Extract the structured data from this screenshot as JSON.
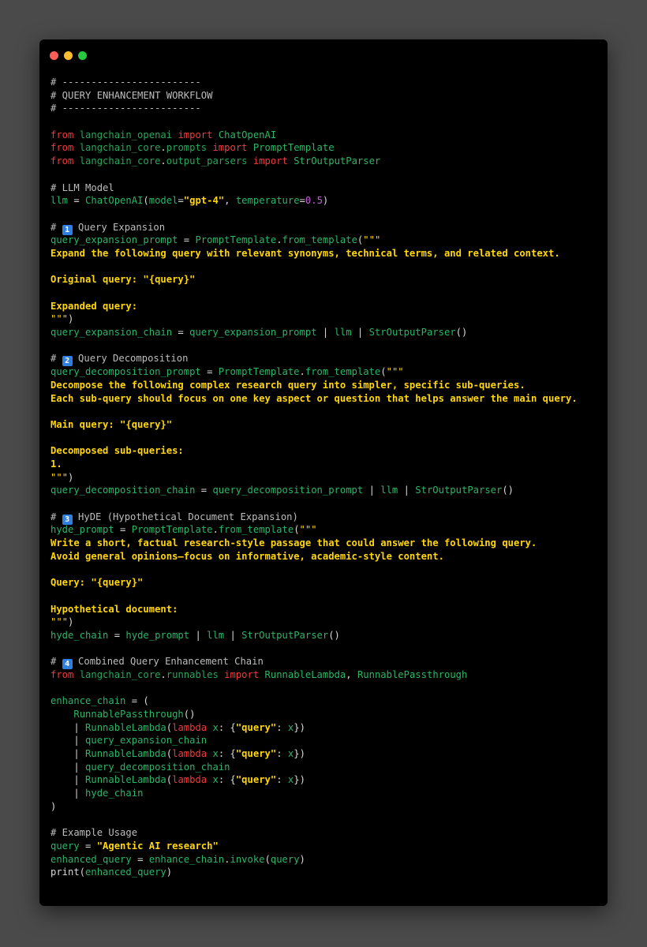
{
  "window": {
    "controls": [
      "close",
      "minimize",
      "zoom"
    ]
  },
  "colors": {
    "background": "#4a4a4a",
    "editor_bg": "#000000",
    "comment": "#bdbdbd",
    "keyword": "#ef3b3b",
    "identifier": "#29b764",
    "string": "#ffd60a",
    "number": "#c75bd8"
  },
  "code": {
    "lines": [
      [
        {
          "t": "comment",
          "v": "# ------------------------"
        }
      ],
      [
        {
          "t": "comment",
          "v": "# QUERY ENHANCEMENT WORKFLOW"
        }
      ],
      [
        {
          "t": "comment",
          "v": "# ------------------------"
        }
      ],
      [],
      [
        {
          "t": "kw",
          "v": "from "
        },
        {
          "t": "mod",
          "v": "langchain_openai "
        },
        {
          "t": "kw",
          "v": "import "
        },
        {
          "t": "cls",
          "v": "ChatOpenAI"
        }
      ],
      [
        {
          "t": "kw",
          "v": "from "
        },
        {
          "t": "mod",
          "v": "langchain_core"
        },
        {
          "t": "plain",
          "v": "."
        },
        {
          "t": "mod",
          "v": "prompts "
        },
        {
          "t": "kw",
          "v": "import "
        },
        {
          "t": "cls",
          "v": "PromptTemplate"
        }
      ],
      [
        {
          "t": "kw",
          "v": "from "
        },
        {
          "t": "mod",
          "v": "langchain_core"
        },
        {
          "t": "plain",
          "v": "."
        },
        {
          "t": "mod",
          "v": "output_parsers "
        },
        {
          "t": "kw",
          "v": "import "
        },
        {
          "t": "cls",
          "v": "StrOutputParser"
        }
      ],
      [],
      [
        {
          "t": "comment",
          "v": "# LLM Model"
        }
      ],
      [
        {
          "t": "id",
          "v": "llm"
        },
        {
          "t": "plain",
          "v": " = "
        },
        {
          "t": "cls",
          "v": "ChatOpenAI"
        },
        {
          "t": "plain",
          "v": "("
        },
        {
          "t": "id",
          "v": "model"
        },
        {
          "t": "plain",
          "v": "="
        },
        {
          "t": "str",
          "v": "\"gpt-4\""
        },
        {
          "t": "plain",
          "v": ", "
        },
        {
          "t": "id",
          "v": "temperature"
        },
        {
          "t": "plain",
          "v": "="
        },
        {
          "t": "num",
          "v": "0.5"
        },
        {
          "t": "plain",
          "v": ")"
        }
      ],
      [],
      [
        {
          "t": "comment",
          "v": "# "
        },
        {
          "t": "badge",
          "v": "1"
        },
        {
          "t": "comment",
          "v": " Query Expansion"
        }
      ],
      [
        {
          "t": "id",
          "v": "query_expansion_prompt"
        },
        {
          "t": "plain",
          "v": " = "
        },
        {
          "t": "cls",
          "v": "PromptTemplate"
        },
        {
          "t": "plain",
          "v": "."
        },
        {
          "t": "id",
          "v": "from_template"
        },
        {
          "t": "plain",
          "v": "("
        },
        {
          "t": "strl",
          "v": "\"\"\""
        }
      ],
      [
        {
          "t": "str",
          "v": "Expand the following query with relevant synonyms, technical terms, and related context."
        }
      ],
      [],
      [
        {
          "t": "str",
          "v": "Original query: \"{query}\""
        }
      ],
      [],
      [
        {
          "t": "str",
          "v": "Expanded query:"
        }
      ],
      [
        {
          "t": "strl",
          "v": "\"\"\""
        },
        {
          "t": "plain",
          "v": ")"
        }
      ],
      [
        {
          "t": "id",
          "v": "query_expansion_chain"
        },
        {
          "t": "plain",
          "v": " = "
        },
        {
          "t": "id",
          "v": "query_expansion_prompt"
        },
        {
          "t": "plain",
          "v": " | "
        },
        {
          "t": "id",
          "v": "llm"
        },
        {
          "t": "plain",
          "v": " | "
        },
        {
          "t": "cls",
          "v": "StrOutputParser"
        },
        {
          "t": "plain",
          "v": "()"
        }
      ],
      [],
      [
        {
          "t": "comment",
          "v": "# "
        },
        {
          "t": "badge",
          "v": "2"
        },
        {
          "t": "comment",
          "v": " Query Decomposition"
        }
      ],
      [
        {
          "t": "id",
          "v": "query_decomposition_prompt"
        },
        {
          "t": "plain",
          "v": " = "
        },
        {
          "t": "cls",
          "v": "PromptTemplate"
        },
        {
          "t": "plain",
          "v": "."
        },
        {
          "t": "id",
          "v": "from_template"
        },
        {
          "t": "plain",
          "v": "("
        },
        {
          "t": "strl",
          "v": "\"\"\""
        }
      ],
      [
        {
          "t": "str",
          "v": "Decompose the following complex research query into simpler, specific sub-queries."
        }
      ],
      [
        {
          "t": "str",
          "v": "Each sub-query should focus on one key aspect or question that helps answer the main query."
        }
      ],
      [],
      [
        {
          "t": "str",
          "v": "Main query: \"{query}\""
        }
      ],
      [],
      [
        {
          "t": "str",
          "v": "Decomposed sub-queries:"
        }
      ],
      [
        {
          "t": "str",
          "v": "1."
        }
      ],
      [
        {
          "t": "strl",
          "v": "\"\"\""
        },
        {
          "t": "plain",
          "v": ")"
        }
      ],
      [
        {
          "t": "id",
          "v": "query_decomposition_chain"
        },
        {
          "t": "plain",
          "v": " = "
        },
        {
          "t": "id",
          "v": "query_decomposition_prompt"
        },
        {
          "t": "plain",
          "v": " | "
        },
        {
          "t": "id",
          "v": "llm"
        },
        {
          "t": "plain",
          "v": " | "
        },
        {
          "t": "cls",
          "v": "StrOutputParser"
        },
        {
          "t": "plain",
          "v": "()"
        }
      ],
      [],
      [
        {
          "t": "comment",
          "v": "# "
        },
        {
          "t": "badge",
          "v": "3"
        },
        {
          "t": "comment",
          "v": " HyDE (Hypothetical Document Expansion)"
        }
      ],
      [
        {
          "t": "id",
          "v": "hyde_prompt"
        },
        {
          "t": "plain",
          "v": " = "
        },
        {
          "t": "cls",
          "v": "PromptTemplate"
        },
        {
          "t": "plain",
          "v": "."
        },
        {
          "t": "id",
          "v": "from_template"
        },
        {
          "t": "plain",
          "v": "("
        },
        {
          "t": "strl",
          "v": "\"\"\""
        }
      ],
      [
        {
          "t": "str",
          "v": "Write a short, factual research-style passage that could answer the following query."
        }
      ],
      [
        {
          "t": "str",
          "v": "Avoid general opinions—focus on informative, academic-style content."
        }
      ],
      [],
      [
        {
          "t": "str",
          "v": "Query: \"{query}\""
        }
      ],
      [],
      [
        {
          "t": "str",
          "v": "Hypothetical document:"
        }
      ],
      [
        {
          "t": "strl",
          "v": "\"\"\""
        },
        {
          "t": "plain",
          "v": ")"
        }
      ],
      [
        {
          "t": "id",
          "v": "hyde_chain"
        },
        {
          "t": "plain",
          "v": " = "
        },
        {
          "t": "id",
          "v": "hyde_prompt"
        },
        {
          "t": "plain",
          "v": " | "
        },
        {
          "t": "id",
          "v": "llm"
        },
        {
          "t": "plain",
          "v": " | "
        },
        {
          "t": "cls",
          "v": "StrOutputParser"
        },
        {
          "t": "plain",
          "v": "()"
        }
      ],
      [],
      [
        {
          "t": "comment",
          "v": "# "
        },
        {
          "t": "badge",
          "v": "4"
        },
        {
          "t": "comment",
          "v": " Combined Query Enhancement Chain"
        }
      ],
      [
        {
          "t": "kw",
          "v": "from "
        },
        {
          "t": "mod",
          "v": "langchain_core"
        },
        {
          "t": "plain",
          "v": "."
        },
        {
          "t": "mod",
          "v": "runnables "
        },
        {
          "t": "kw",
          "v": "import "
        },
        {
          "t": "cls",
          "v": "RunnableLambda"
        },
        {
          "t": "plain",
          "v": ", "
        },
        {
          "t": "cls",
          "v": "RunnablePassthrough"
        }
      ],
      [],
      [
        {
          "t": "id",
          "v": "enhance_chain"
        },
        {
          "t": "plain",
          "v": " = ("
        }
      ],
      [
        {
          "t": "plain",
          "v": "    "
        },
        {
          "t": "cls",
          "v": "RunnablePassthrough"
        },
        {
          "t": "plain",
          "v": "()"
        }
      ],
      [
        {
          "t": "plain",
          "v": "    | "
        },
        {
          "t": "cls",
          "v": "RunnableLambda"
        },
        {
          "t": "plain",
          "v": "("
        },
        {
          "t": "kw",
          "v": "lambda "
        },
        {
          "t": "id",
          "v": "x"
        },
        {
          "t": "plain",
          "v": ": {"
        },
        {
          "t": "str",
          "v": "\"query\""
        },
        {
          "t": "plain",
          "v": ": "
        },
        {
          "t": "id",
          "v": "x"
        },
        {
          "t": "plain",
          "v": "})"
        }
      ],
      [
        {
          "t": "plain",
          "v": "    | "
        },
        {
          "t": "id",
          "v": "query_expansion_chain"
        }
      ],
      [
        {
          "t": "plain",
          "v": "    | "
        },
        {
          "t": "cls",
          "v": "RunnableLambda"
        },
        {
          "t": "plain",
          "v": "("
        },
        {
          "t": "kw",
          "v": "lambda "
        },
        {
          "t": "id",
          "v": "x"
        },
        {
          "t": "plain",
          "v": ": {"
        },
        {
          "t": "str",
          "v": "\"query\""
        },
        {
          "t": "plain",
          "v": ": "
        },
        {
          "t": "id",
          "v": "x"
        },
        {
          "t": "plain",
          "v": "})"
        }
      ],
      [
        {
          "t": "plain",
          "v": "    | "
        },
        {
          "t": "id",
          "v": "query_decomposition_chain"
        }
      ],
      [
        {
          "t": "plain",
          "v": "    | "
        },
        {
          "t": "cls",
          "v": "RunnableLambda"
        },
        {
          "t": "plain",
          "v": "("
        },
        {
          "t": "kw",
          "v": "lambda "
        },
        {
          "t": "id",
          "v": "x"
        },
        {
          "t": "plain",
          "v": ": {"
        },
        {
          "t": "str",
          "v": "\"query\""
        },
        {
          "t": "plain",
          "v": ": "
        },
        {
          "t": "id",
          "v": "x"
        },
        {
          "t": "plain",
          "v": "})"
        }
      ],
      [
        {
          "t": "plain",
          "v": "    | "
        },
        {
          "t": "id",
          "v": "hyde_chain"
        }
      ],
      [
        {
          "t": "plain",
          "v": ")"
        }
      ],
      [],
      [
        {
          "t": "comment",
          "v": "# Example Usage"
        }
      ],
      [
        {
          "t": "id",
          "v": "query"
        },
        {
          "t": "plain",
          "v": " = "
        },
        {
          "t": "str",
          "v": "\"Agentic AI research\""
        }
      ],
      [
        {
          "t": "id",
          "v": "enhanced_query"
        },
        {
          "t": "plain",
          "v": " = "
        },
        {
          "t": "id",
          "v": "enhance_chain"
        },
        {
          "t": "plain",
          "v": "."
        },
        {
          "t": "id",
          "v": "invoke"
        },
        {
          "t": "plain",
          "v": "("
        },
        {
          "t": "id",
          "v": "query"
        },
        {
          "t": "plain",
          "v": ")"
        }
      ],
      [
        {
          "t": "plain",
          "v": "print("
        },
        {
          "t": "id",
          "v": "enhanced_query"
        },
        {
          "t": "plain",
          "v": ")"
        }
      ]
    ]
  }
}
